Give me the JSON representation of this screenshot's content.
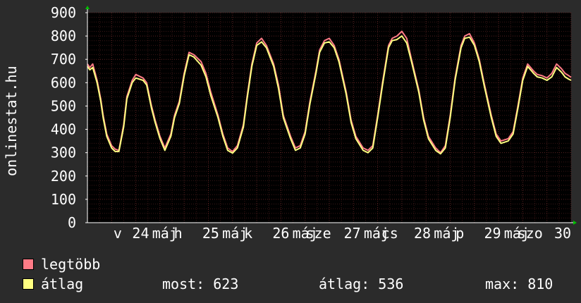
{
  "chart_data": {
    "type": "line",
    "ylabel": "onlinestat.hu",
    "ylim": [
      0,
      900
    ],
    "yticks": [
      0,
      100,
      200,
      300,
      400,
      500,
      600,
      700,
      800,
      900
    ],
    "xticklabels": [
      "v",
      "24",
      "máj",
      "h",
      "25",
      "máj",
      "k",
      "26",
      "máj",
      "sze",
      "27",
      "máj",
      "cs",
      "28",
      "máj",
      "p",
      "29",
      "máj",
      "szo",
      "30"
    ],
    "grid": true,
    "colors": {
      "background": "#2b2b2b",
      "plot": "#000000",
      "grid": "#5a2222",
      "max": "#ff7b86",
      "avg": "#ffff80",
      "axis": "#ffffff",
      "arrow": "#00c000"
    },
    "series": [
      {
        "name": "legtöbb",
        "x": [
          0,
          0.1,
          0.22,
          0.4,
          0.55,
          0.65,
          0.8,
          1.0,
          1.15,
          1.3,
          1.5,
          1.63,
          1.85,
          2.0,
          2.3,
          2.45,
          2.65,
          2.8,
          3.0,
          3.2,
          3.45,
          3.6,
          3.8,
          4.0,
          4.2,
          4.4,
          4.7,
          4.9,
          5.1,
          5.4,
          5.6,
          5.8,
          6.0,
          6.2,
          6.45,
          6.6,
          6.8,
          7.0,
          7.2,
          7.4,
          7.7,
          7.9,
          8.1,
          8.4,
          8.6,
          8.8,
          9.0,
          9.2,
          9.45,
          9.6,
          9.8,
          10.0,
          10.2,
          10.4,
          10.7,
          10.9,
          11.1,
          11.4,
          11.6,
          11.8,
          12.0,
          12.2,
          12.45,
          12.6,
          12.8,
          13.0,
          13.2,
          13.4,
          13.7,
          13.9,
          14.1,
          14.4,
          14.6,
          14.8,
          15.0,
          15.2,
          15.45,
          15.6,
          15.8,
          16.0,
          16.2,
          16.4,
          16.7,
          16.9,
          17.1,
          17.4,
          17.6,
          17.8,
          18.0,
          18.2,
          18.45,
          18.6,
          18.8,
          19.0,
          19.2,
          19.4,
          19.6,
          19.75,
          19.9,
          20.0
        ],
        "values": [
          680,
          665,
          680,
          610,
          530,
          460,
          380,
          330,
          315,
          310,
          420,
          540,
          610,
          635,
          620,
          600,
          500,
          440,
          370,
          320,
          380,
          460,
          520,
          640,
          730,
          720,
          690,
          640,
          560,
          460,
          380,
          320,
          305,
          330,
          420,
          540,
          680,
          770,
          790,
          760,
          680,
          590,
          460,
          370,
          320,
          330,
          390,
          520,
          650,
          740,
          780,
          790,
          760,
          700,
          560,
          440,
          370,
          320,
          310,
          330,
          460,
          600,
          760,
          790,
          800,
          820,
          790,
          700,
          570,
          450,
          370,
          320,
          300,
          330,
          460,
          620,
          760,
          800,
          810,
          770,
          700,
          600,
          460,
          380,
          350,
          360,
          390,
          500,
          620,
          680,
          650,
          635,
          630,
          620,
          640,
          680,
          660,
          640,
          630,
          623
        ]
      },
      {
        "name": "átlag",
        "x": [
          0,
          0.1,
          0.22,
          0.4,
          0.55,
          0.65,
          0.8,
          1.0,
          1.15,
          1.3,
          1.5,
          1.63,
          1.85,
          2.0,
          2.3,
          2.45,
          2.65,
          2.8,
          3.0,
          3.2,
          3.45,
          3.6,
          3.8,
          4.0,
          4.2,
          4.4,
          4.7,
          4.9,
          5.1,
          5.4,
          5.6,
          5.8,
          6.0,
          6.2,
          6.45,
          6.6,
          6.8,
          7.0,
          7.2,
          7.4,
          7.7,
          7.9,
          8.1,
          8.4,
          8.6,
          8.8,
          9.0,
          9.2,
          9.45,
          9.6,
          9.8,
          10.0,
          10.2,
          10.4,
          10.7,
          10.9,
          11.1,
          11.4,
          11.6,
          11.8,
          12.0,
          12.2,
          12.45,
          12.6,
          12.8,
          13.0,
          13.2,
          13.4,
          13.7,
          13.9,
          14.1,
          14.4,
          14.6,
          14.8,
          15.0,
          15.2,
          15.45,
          15.6,
          15.8,
          16.0,
          16.2,
          16.4,
          16.7,
          16.9,
          17.1,
          17.4,
          17.6,
          17.8,
          18.0,
          18.2,
          18.45,
          18.6,
          18.8,
          19.0,
          19.2,
          19.4,
          19.6,
          19.75,
          19.9,
          20.0
        ],
        "values": [
          670,
          655,
          665,
          600,
          520,
          450,
          370,
          320,
          305,
          305,
          410,
          530,
          600,
          620,
          610,
          590,
          490,
          430,
          360,
          310,
          370,
          450,
          510,
          630,
          720,
          710,
          675,
          625,
          545,
          450,
          370,
          310,
          298,
          320,
          410,
          530,
          670,
          760,
          775,
          750,
          670,
          575,
          450,
          360,
          310,
          320,
          380,
          510,
          640,
          730,
          770,
          775,
          750,
          690,
          550,
          430,
          360,
          310,
          300,
          320,
          450,
          590,
          750,
          780,
          785,
          800,
          770,
          690,
          560,
          440,
          360,
          310,
          295,
          320,
          450,
          610,
          750,
          790,
          795,
          760,
          690,
          590,
          450,
          370,
          340,
          350,
          380,
          490,
          610,
          670,
          640,
          625,
          620,
          610,
          625,
          665,
          645,
          625,
          615,
          610
        ]
      }
    ],
    "legend": [
      {
        "label": "legtöbb",
        "color": "#ff7b86"
      },
      {
        "label": "átlag",
        "color": "#ffff80"
      }
    ],
    "stats": {
      "most": "most: 623",
      "atlag": "átlag: 536",
      "max": "max: 810"
    }
  }
}
